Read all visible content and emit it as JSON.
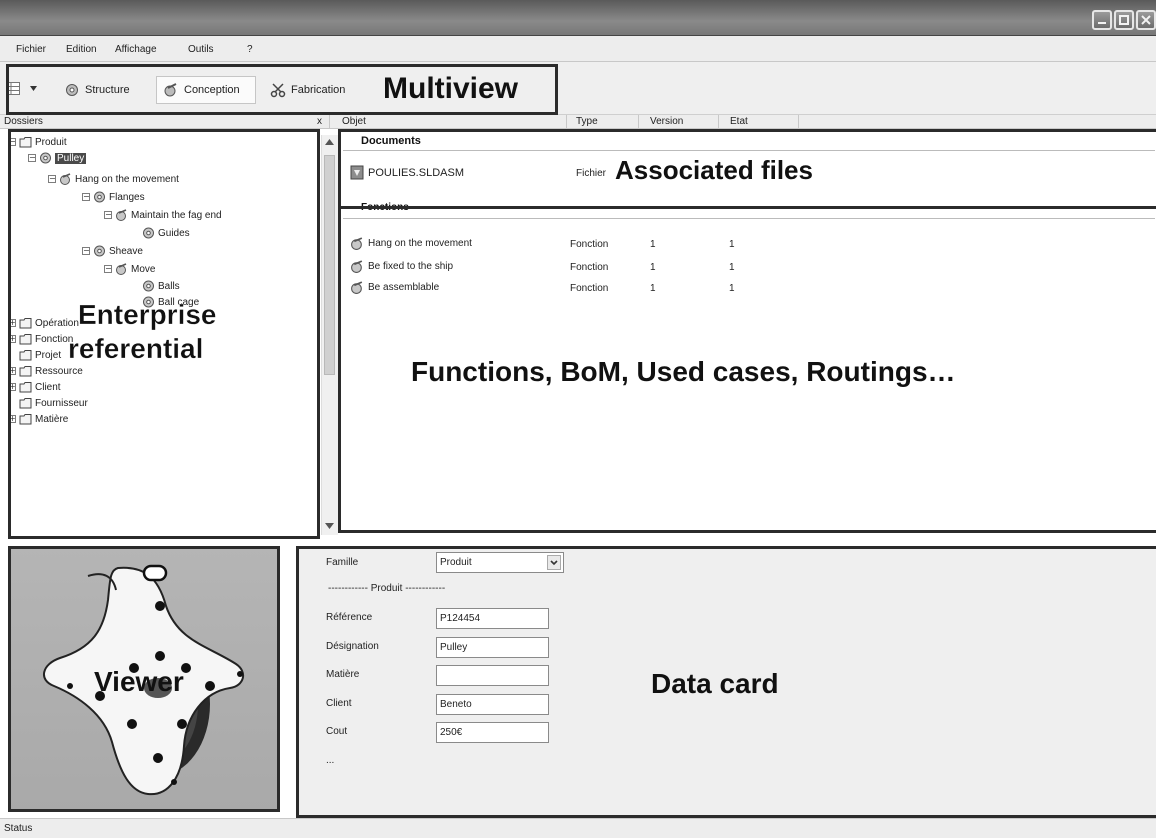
{
  "window": {
    "title": ""
  },
  "menu": {
    "items": [
      "Fichier",
      "Edition",
      "Affichage",
      "Outils",
      "?"
    ]
  },
  "toolbar": {
    "structure_label": "Structure",
    "conception_label": "Conception",
    "fabrication_label": "Fabrication"
  },
  "annotations": {
    "multiview": "Multiview",
    "associated_files": "Associated files",
    "enterprise_line1": "Enterprise",
    "enterprise_line2": "referential",
    "functions": "Functions, BoM, Used cases, Routings…",
    "viewer": "Viewer",
    "data_card": "Data card"
  },
  "panels": {
    "folders_title": "Dossiers",
    "close_glyph": "x",
    "columns": [
      "Objet",
      "Type",
      "Version",
      "Etat"
    ]
  },
  "tree": {
    "produit": "Produit",
    "pulley": "Pulley",
    "hang": "Hang on the movement",
    "flanges": "Flanges",
    "maintain": "Maintain the fag end",
    "guides": "Guides",
    "sheave": "Sheave",
    "move": "Move",
    "balls": "Balls",
    "ballcage": "Ball cage",
    "operation": "Opération",
    "fonction": "Fonction",
    "projet": "Projet",
    "ressource": "Ressource",
    "client": "Client",
    "fournisseur": "Fournisseur",
    "matiere": "Matière"
  },
  "documents": {
    "header": "Documents",
    "rows": [
      {
        "name": "POULIES.SLDASM",
        "type": "Fichier"
      }
    ]
  },
  "fonctions": {
    "header": "Fonctions",
    "rows": [
      {
        "name": "Hang on the movement",
        "type": "Fonction",
        "version": "1",
        "etat": "1"
      },
      {
        "name": "Be fixed to the ship",
        "type": "Fonction",
        "version": "1",
        "etat": "1"
      },
      {
        "name": "Be assemblable",
        "type": "Fonction",
        "version": "1",
        "etat": "1"
      }
    ]
  },
  "datacard": {
    "famille_label": "Famille",
    "famille_value": "Produit",
    "section_label": "------------ Produit ------------",
    "fields": [
      {
        "label": "Référence",
        "value": "P124454"
      },
      {
        "label": "Désignation",
        "value": "Pulley"
      },
      {
        "label": "Matière",
        "value": ""
      },
      {
        "label": "Client",
        "value": "Beneto"
      },
      {
        "label": "Cout",
        "value": "250€"
      }
    ],
    "more": "..."
  },
  "status": {
    "text": "Status"
  },
  "colors": {
    "frame": "#2b2b2b",
    "selected": "#4a4a4a",
    "titlebar": "#777777"
  },
  "icons": [
    "gear-icon",
    "folder-icon",
    "file-icon",
    "function-icon",
    "scissors-icon",
    "grid-icon",
    "chevron-down-icon"
  ]
}
